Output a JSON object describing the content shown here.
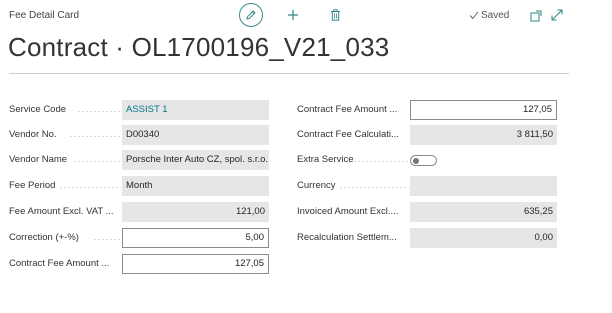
{
  "header": {
    "caption": "Fee Detail Card",
    "saved": "Saved",
    "title": "Contract · OL1700196_V21_033"
  },
  "colors": {
    "accent": "#00798a",
    "readonly_bg": "#e6e6e6"
  },
  "left_fields": [
    {
      "label": "Service Code",
      "value": "ASSIST 1"
    },
    {
      "label": "Vendor No.",
      "value": "D00340"
    },
    {
      "label": "Vendor Name",
      "value": "Porsche Inter Auto CZ, spol. s.r.o."
    },
    {
      "label": "Fee Period",
      "value": "Month"
    },
    {
      "label": "Fee Amount Excl. VAT ...",
      "value": "121,00"
    },
    {
      "label": "Correction (+-%)",
      "value": "5,00"
    },
    {
      "label": "Contract Fee Amount ...",
      "value": "127,05"
    }
  ],
  "right_fields": [
    {
      "label": "Contract Fee Amount ...",
      "value": "127,05"
    },
    {
      "label": "Contract Fee Calculati...",
      "value": "3 811,50"
    },
    {
      "label": "Extra Service",
      "value": "off"
    },
    {
      "label": "Currency",
      "value": ""
    },
    {
      "label": "Invoiced Amount Excl....",
      "value": "635,25"
    },
    {
      "label": "Recalculation Settlem...",
      "value": "0,00"
    }
  ]
}
